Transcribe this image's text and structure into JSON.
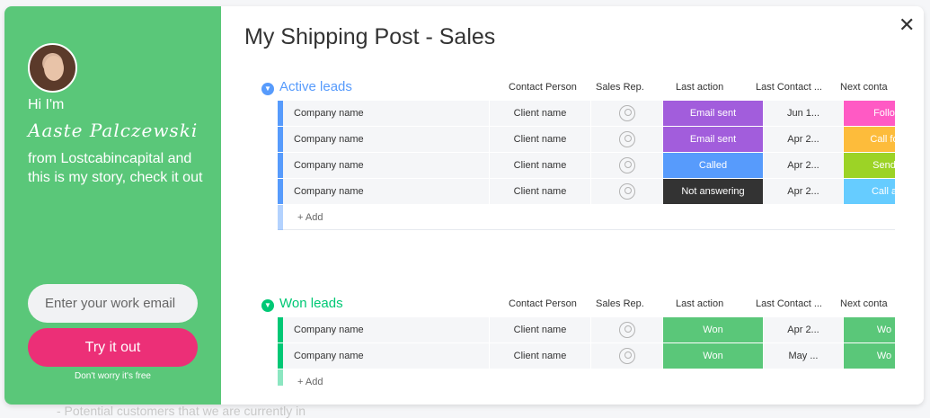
{
  "background_text": "- Potential customers that we are currently in",
  "left": {
    "greeting": "Hi I'm",
    "signature": "Aaste Palczewski",
    "story": "from Lostcabincapital and this is my story, check it out",
    "email_placeholder": "Enter your work email",
    "cta": "Try it out",
    "free_note": "Don't worry it's free"
  },
  "board": {
    "title": "My Shipping Post - Sales",
    "columns": [
      "Contact Person",
      "Sales Rep.",
      "Last action",
      "Last Contact ...",
      "Next conta"
    ],
    "add_label": "+ Add",
    "groups": [
      {
        "name": "Active leads",
        "color": "#579bfc",
        "rows": [
          {
            "name": "Company name",
            "contact": "Client name",
            "action": "Email sent",
            "action_color": "#a25ddc",
            "last": "Jun 1...",
            "next": "Follo",
            "next_color": "#ff5ac4"
          },
          {
            "name": "Company name",
            "contact": "Client name",
            "action": "Email sent",
            "action_color": "#a25ddc",
            "last": "Apr 2...",
            "next": "Call fo",
            "next_color": "#fdbc3b"
          },
          {
            "name": "Company name",
            "contact": "Client name",
            "action": "Called",
            "action_color": "#579bfc",
            "last": "Apr 2...",
            "next": "Send",
            "next_color": "#9cd326"
          },
          {
            "name": "Company name",
            "contact": "Client name",
            "action": "Not answering",
            "action_color": "#333333",
            "last": "Apr 2...",
            "next": "Call a",
            "next_color": "#66ccff"
          }
        ]
      },
      {
        "name": "Won leads",
        "color": "#00c875",
        "rows": [
          {
            "name": "Company name",
            "contact": "Client name",
            "action": "Won",
            "action_color": "#5ac779",
            "last": "Apr 2...",
            "next": "Wo",
            "next_color": "#5ac779"
          },
          {
            "name": "Company name",
            "contact": "Client name",
            "action": "Won",
            "action_color": "#5ac779",
            "last": "May ...",
            "next": "Wo",
            "next_color": "#5ac779"
          }
        ]
      }
    ]
  }
}
